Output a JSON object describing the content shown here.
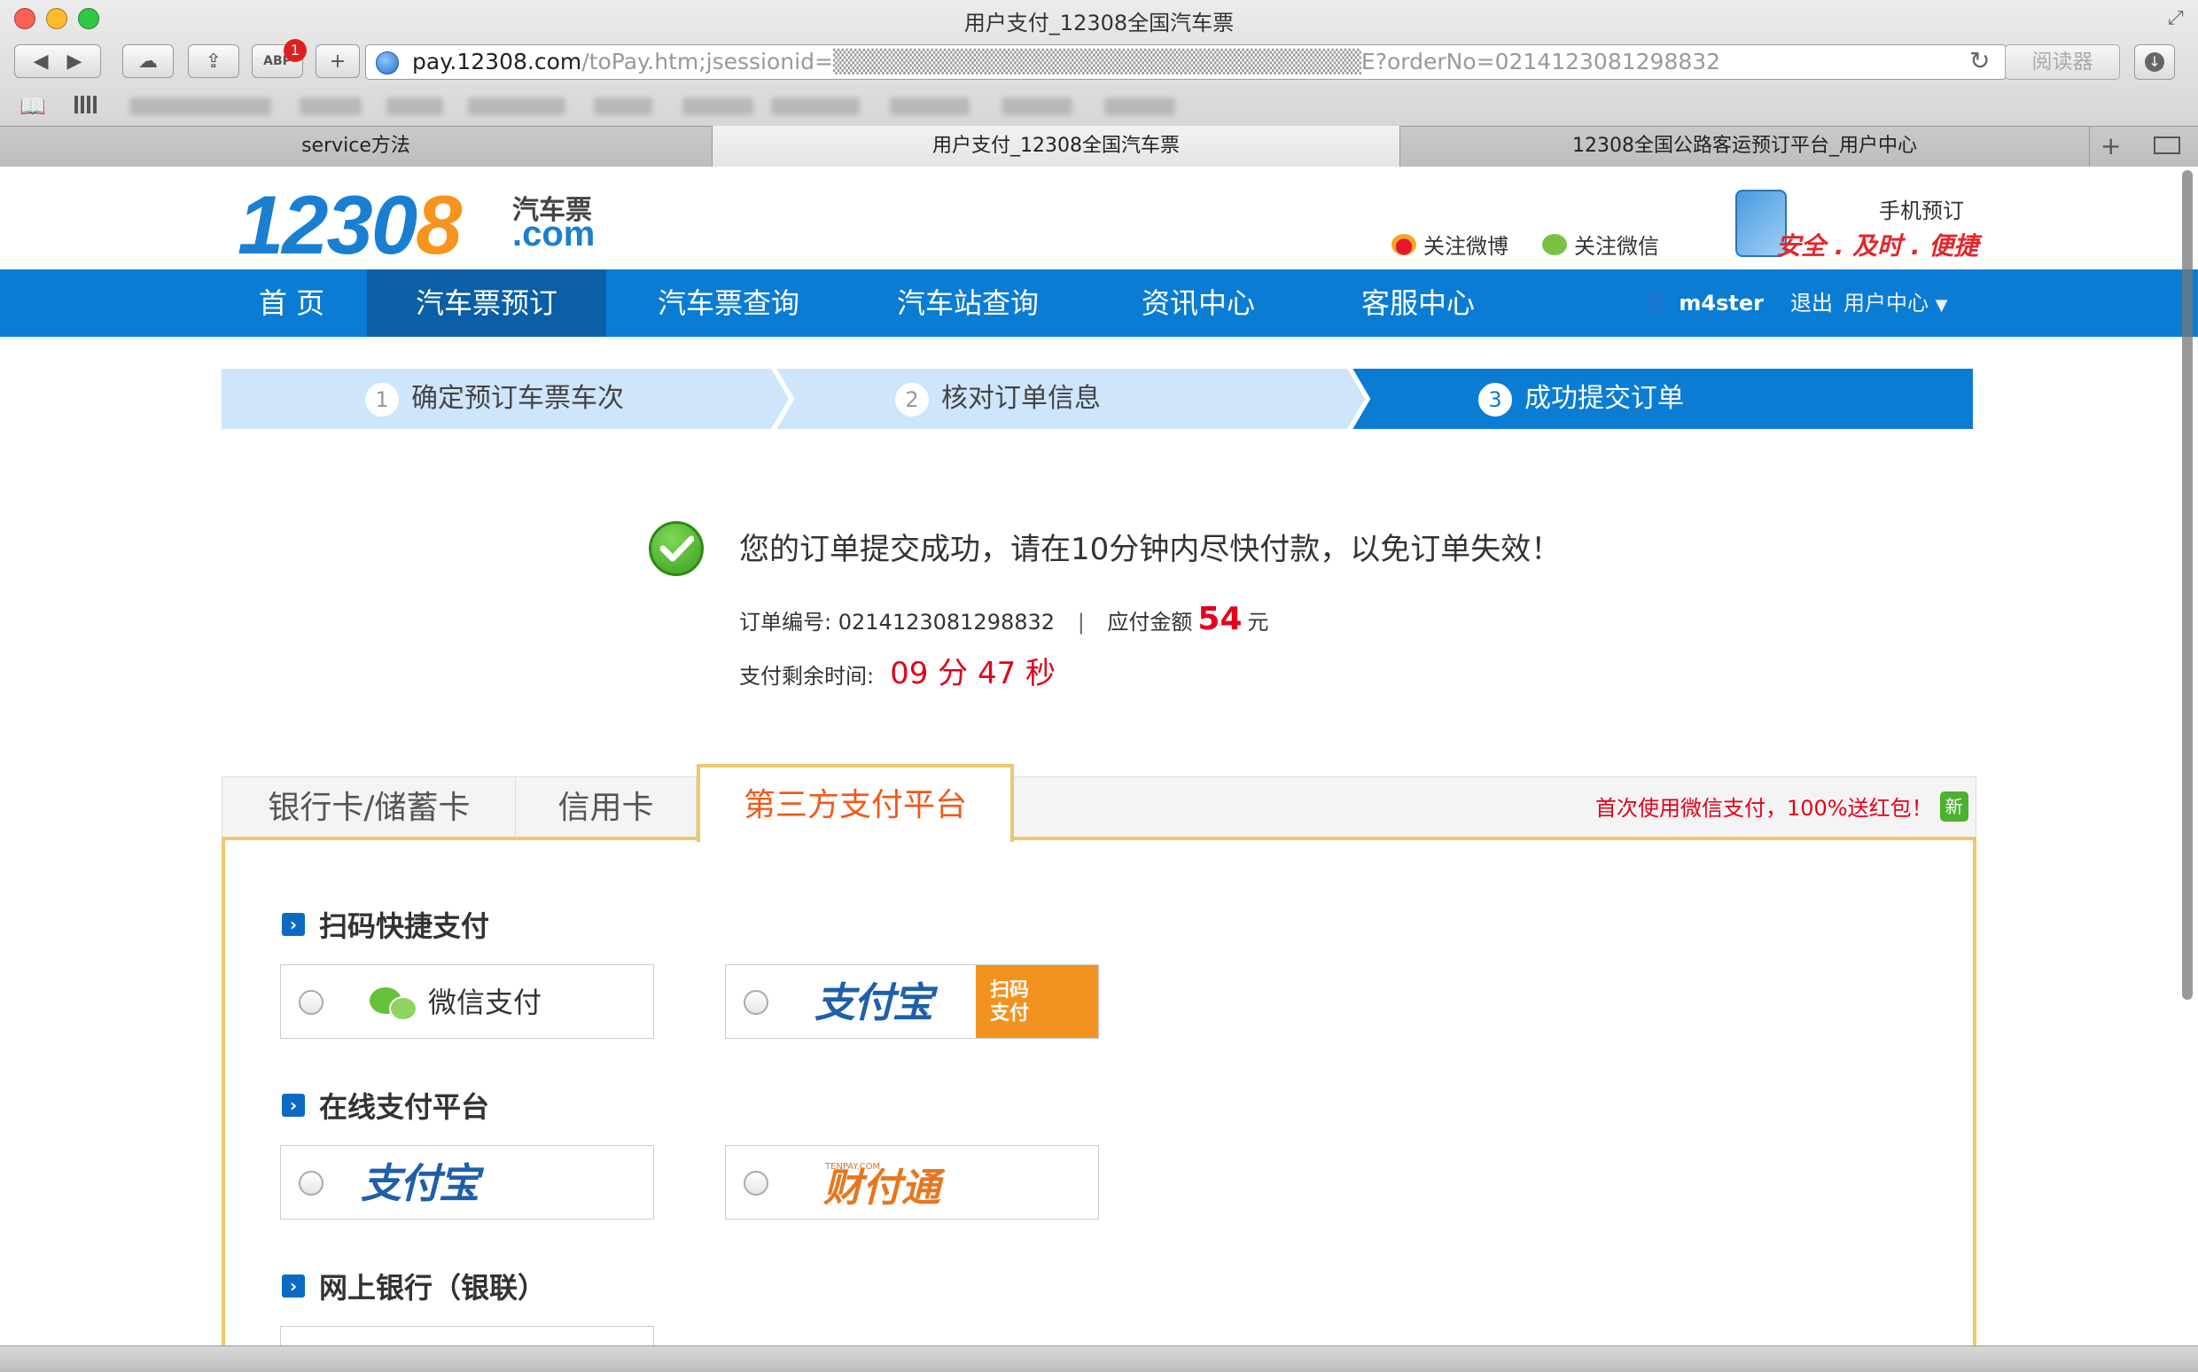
{
  "browser": {
    "window_title": "用户支付_12308全国汽车票",
    "url_host": "pay.12308.com",
    "url_rest": "/toPay.htm;jsessionid=▒▒▒▒▒▒▒▒▒▒▒▒▒▒▒▒▒▒▒▒▒▒▒▒▒▒▒▒▒▒▒E?orderNo=0214123081298832",
    "reader_label": "阅读器",
    "abp_badge": "1",
    "abp_label": "ABP",
    "new_tab_label": "+",
    "tabs": [
      {
        "label": "service方法",
        "active": false
      },
      {
        "label": "用户支付_12308全国汽车票",
        "active": true
      },
      {
        "label": "12308全国公路客运预订平台_用户中心",
        "active": false
      }
    ]
  },
  "site": {
    "logo_number": "1230",
    "logo_number_last": "8",
    "logo_cn": "汽车票",
    "logo_com": ".com",
    "follow_weibo": "关注微博",
    "follow_wechat": "关注微信",
    "mobile_label": "手机预订",
    "mobile_slogan": "安全 . 及时 . 便捷"
  },
  "nav": {
    "items": [
      {
        "label": "首 页",
        "active": false
      },
      {
        "label": "汽车票预订",
        "active": true
      },
      {
        "label": "汽车票查询",
        "active": false
      },
      {
        "label": "汽车站查询",
        "active": false
      },
      {
        "label": "资讯中心",
        "active": false
      },
      {
        "label": "客服中心",
        "active": false
      }
    ],
    "username": "m4ster",
    "logout": "退出",
    "user_center": "用户中心"
  },
  "steps": [
    {
      "num": "1",
      "label": "确定预订车票车次",
      "active": false
    },
    {
      "num": "2",
      "label": "核对订单信息",
      "active": false
    },
    {
      "num": "3",
      "label": "成功提交订单",
      "active": true
    }
  ],
  "order": {
    "success_message": "您的订单提交成功，请在10分钟内尽快付款，以免订单失效！",
    "order_no_label": "订单编号:",
    "order_no": "0214123081298832",
    "separator": "|",
    "amount_label": "应付金额",
    "amount": "54",
    "amount_unit": "元",
    "remaining_label": "支付剩余时间:",
    "remaining": "09 分 47 秒"
  },
  "payment": {
    "tabs": [
      {
        "label": "银行卡/储蓄卡",
        "active": false
      },
      {
        "label": "信用卡",
        "active": false
      },
      {
        "label": "第三方支付平台",
        "active": true
      }
    ],
    "promo": "首次使用微信支付，100%送红包！",
    "promo_badge": "新",
    "sections": [
      {
        "title": "扫码快捷支付",
        "options": [
          "微信支付",
          "支付宝 扫码支付"
        ]
      },
      {
        "title": "在线支付平台",
        "options": [
          "支付宝",
          "财付通"
        ]
      },
      {
        "title": "网上银行（银联）",
        "options": []
      }
    ],
    "wechat_label": "微信支付",
    "alipay_text": "支付宝",
    "alipay_scan": "扫码\n支付",
    "tenpay_text": "财付通",
    "tenpay_small": "TENPAY.COM"
  },
  "colors": {
    "nav_blue": "#0b7cd4",
    "nav_active": "#0a5fa6",
    "step_inactive": "#cfe5fb",
    "step_active": "#0b7cd4",
    "accent_red": "#e3001b",
    "panel_border": "#edc86f",
    "tab_active_text": "#f05a1a"
  }
}
